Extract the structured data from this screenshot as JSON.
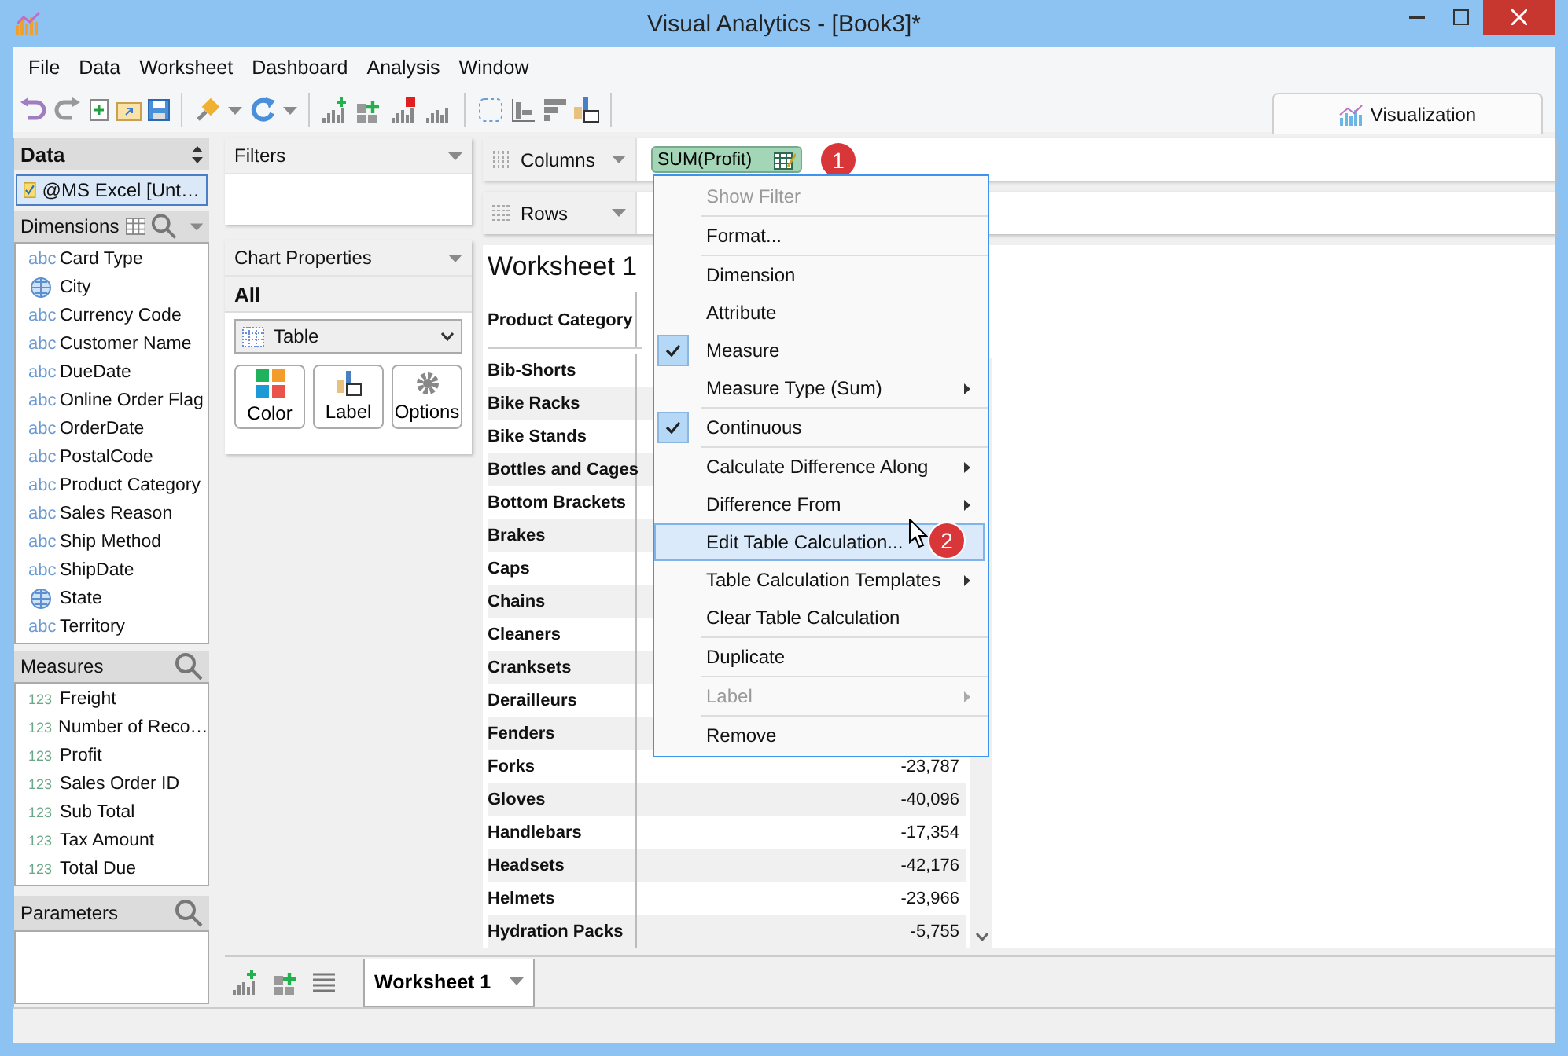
{
  "window": {
    "title": "Visual Analytics - [Book3]*"
  },
  "menu_bar": [
    "File",
    "Data",
    "Worksheet",
    "Dashboard",
    "Analysis",
    "Window"
  ],
  "visualization_tab": {
    "label": "Visualization",
    "selected": true
  },
  "data_panel": {
    "title": "Data",
    "source": "@MS Excel [Unt…",
    "source_selected": true
  },
  "dimensions": {
    "title": "Dimensions",
    "items": [
      {
        "kind": "text",
        "type_label": "abc",
        "label": "Card Type"
      },
      {
        "kind": "geo",
        "label": "City"
      },
      {
        "kind": "text",
        "type_label": "abc",
        "label": "Currency Code"
      },
      {
        "kind": "text",
        "type_label": "abc",
        "label": "Customer Name"
      },
      {
        "kind": "text",
        "type_label": "abc",
        "label": "DueDate"
      },
      {
        "kind": "text",
        "type_label": "abc",
        "label": "Online Order Flag"
      },
      {
        "kind": "text",
        "type_label": "abc",
        "label": "OrderDate"
      },
      {
        "kind": "text",
        "type_label": "abc",
        "label": "PostalCode"
      },
      {
        "kind": "text",
        "type_label": "abc",
        "label": "Product Category"
      },
      {
        "kind": "text",
        "type_label": "abc",
        "label": "Sales Reason"
      },
      {
        "kind": "text",
        "type_label": "abc",
        "label": "Ship Method"
      },
      {
        "kind": "text",
        "type_label": "abc",
        "label": "ShipDate"
      },
      {
        "kind": "geo",
        "label": "State"
      },
      {
        "kind": "text",
        "type_label": "abc",
        "label": "Territory"
      }
    ]
  },
  "measures": {
    "title": "Measures",
    "items": [
      {
        "type_label": "123",
        "label": "Freight"
      },
      {
        "type_label": "123",
        "label": "Number of Reco…"
      },
      {
        "type_label": "123",
        "label": "Profit"
      },
      {
        "type_label": "123",
        "label": "Sales Order ID"
      },
      {
        "type_label": "123",
        "label": "Sub Total"
      },
      {
        "type_label": "123",
        "label": "Tax Amount"
      },
      {
        "type_label": "123",
        "label": "Total Due"
      }
    ]
  },
  "parameters": {
    "title": "Parameters"
  },
  "filters": {
    "title": "Filters"
  },
  "chart_properties": {
    "title": "Chart Properties",
    "section": "All",
    "chart_type": "Table",
    "buttons": [
      {
        "kind": "color",
        "label": "Color"
      },
      {
        "kind": "label",
        "label": "Label"
      },
      {
        "kind": "options",
        "label": "Options"
      }
    ]
  },
  "columns_shelf": {
    "label": "Columns",
    "pills": [
      {
        "label": "SUM(Profit)",
        "badge": "1"
      }
    ]
  },
  "rows_shelf": {
    "label": "Rows"
  },
  "worksheet": {
    "title": "Worksheet 1",
    "row_header": "Product Category",
    "rows": [
      {
        "category": "Bib-Shorts"
      },
      {
        "category": "Bike Racks"
      },
      {
        "category": "Bike Stands"
      },
      {
        "category": "Bottles and Cages"
      },
      {
        "category": "Bottom Brackets"
      },
      {
        "category": "Brakes"
      },
      {
        "category": "Caps"
      },
      {
        "category": "Chains"
      },
      {
        "category": "Cleaners"
      },
      {
        "category": "Cranksets"
      },
      {
        "category": "Derailleurs"
      },
      {
        "category": "Fenders"
      },
      {
        "category": "Forks",
        "value": "-23,787"
      },
      {
        "category": "Gloves",
        "value": "-40,096"
      },
      {
        "category": "Handlebars",
        "value": "-17,354"
      },
      {
        "category": "Headsets",
        "value": "-42,176"
      },
      {
        "category": "Helmets",
        "value": "-23,966"
      },
      {
        "category": "Hydration Packs",
        "value": "-5,755"
      }
    ]
  },
  "context_menu": {
    "groups": [
      [
        {
          "label": "Show Filter",
          "disabled": true,
          "checked": false,
          "submenu": false,
          "selected": false
        }
      ],
      [
        {
          "label": "Format...",
          "disabled": false,
          "checked": false,
          "submenu": false,
          "selected": false
        }
      ],
      [
        {
          "label": "Dimension",
          "disabled": false,
          "checked": false,
          "submenu": false,
          "selected": false
        },
        {
          "label": "Attribute",
          "disabled": false,
          "checked": false,
          "submenu": false,
          "selected": false
        },
        {
          "label": "Measure",
          "disabled": false,
          "checked": true,
          "submenu": false,
          "selected": false
        },
        {
          "label": "Measure Type (Sum)",
          "disabled": false,
          "checked": false,
          "submenu": true,
          "selected": false
        }
      ],
      [
        {
          "label": "Continuous",
          "disabled": false,
          "checked": true,
          "submenu": false,
          "selected": false
        }
      ],
      [
        {
          "label": "Calculate Difference Along",
          "disabled": false,
          "checked": false,
          "submenu": true,
          "selected": false
        },
        {
          "label": "Difference From",
          "disabled": false,
          "checked": false,
          "submenu": true,
          "selected": false
        },
        {
          "label": "Edit Table Calculation...",
          "disabled": false,
          "checked": false,
          "submenu": false,
          "selected": true,
          "badge": "2"
        },
        {
          "label": "Table Calculation Templates",
          "disabled": false,
          "checked": false,
          "submenu": true,
          "selected": false
        },
        {
          "label": "Clear Table Calculation",
          "disabled": false,
          "checked": false,
          "submenu": false,
          "selected": false
        }
      ],
      [
        {
          "label": "Duplicate",
          "disabled": false,
          "checked": false,
          "submenu": false,
          "selected": false
        }
      ],
      [
        {
          "label": "Label",
          "disabled": true,
          "checked": false,
          "submenu": true,
          "selected": false
        }
      ],
      [
        {
          "label": "Remove",
          "disabled": false,
          "checked": false,
          "submenu": false,
          "selected": false
        }
      ]
    ]
  },
  "sheet_tabs": [
    {
      "label": "Worksheet 1",
      "selected": true
    }
  ]
}
